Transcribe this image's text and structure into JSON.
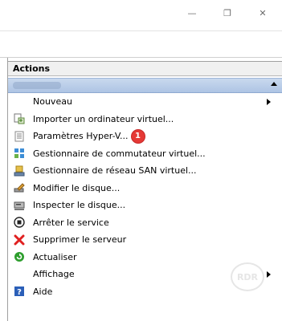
{
  "window": {
    "minimize_glyph": "—",
    "restore_glyph": "❐",
    "close_glyph": "✕"
  },
  "actions": {
    "header": "Actions",
    "items": [
      {
        "label": "Nouveau",
        "icon": "none",
        "submenu": true
      },
      {
        "label": "Importer un ordinateur virtuel...",
        "icon": "import-vm-icon"
      },
      {
        "label": "Paramètres Hyper-V...",
        "icon": "settings-doc-icon",
        "badge": "1"
      },
      {
        "label": "Gestionnaire de commutateur virtuel...",
        "icon": "network-switch-icon"
      },
      {
        "label": "Gestionnaire de réseau SAN virtuel...",
        "icon": "san-icon"
      },
      {
        "label": "Modifier le disque...",
        "icon": "edit-disk-icon"
      },
      {
        "label": "Inspecter le disque...",
        "icon": "inspect-disk-icon"
      },
      {
        "label": "Arrêter le service",
        "icon": "stop-icon"
      },
      {
        "label": "Supprimer le serveur",
        "icon": "delete-x-icon"
      },
      {
        "label": "Actualiser",
        "icon": "refresh-icon"
      },
      {
        "label": "Affichage",
        "icon": "none",
        "submenu": true
      },
      {
        "label": "Aide",
        "icon": "help-icon"
      }
    ]
  },
  "colors": {
    "group_header": "#aec4e4",
    "badge": "#e53935",
    "delete": "#e02020",
    "refresh": "#2e9e2e",
    "help": "#2b5fb8"
  }
}
